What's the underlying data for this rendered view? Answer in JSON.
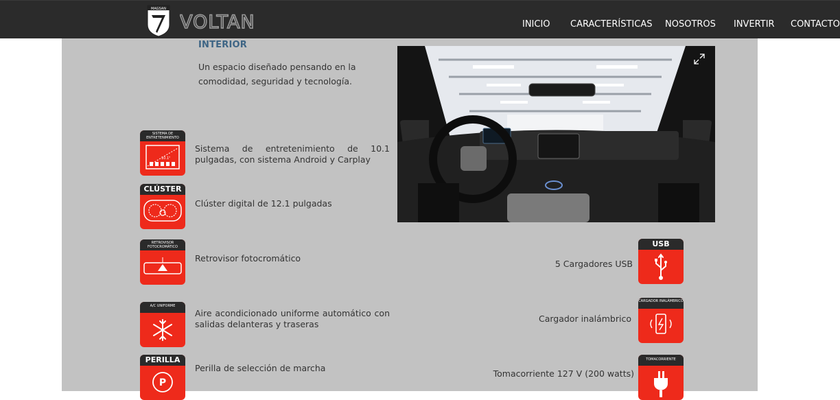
{
  "header": {
    "logo_badge_text": "MAGSAN",
    "logo_word": "VOLTAN",
    "nav": [
      {
        "label": "INICIO"
      },
      {
        "label": "CARACTERÍSTICAS"
      },
      {
        "label": "NOSOTROS"
      },
      {
        "label": "INVERTIR"
      },
      {
        "label": "CONTACTO"
      }
    ]
  },
  "section": {
    "title": "INTERIOR",
    "description": "Un espacio diseñado pensando en la comodidad, seguridad y tecnología."
  },
  "features_left": [
    {
      "icon_caption": "SISTEMA DE ENTRETENIMIENTO",
      "icon": "screen-size-icon",
      "text": "Sistema de entretenimiento de 10.1 pulgadas, con sistema Android y Carplay"
    },
    {
      "icon_caption": "CLÚSTER",
      "icon": "gauge-cluster-icon",
      "text": "Clúster digital de 12.1 pulgadas"
    },
    {
      "icon_caption": "RETROVISOR FOTOCROMÁTICO",
      "icon": "rearview-mirror-icon",
      "text": "Retrovisor fotocromático"
    },
    {
      "icon_caption": "A/C UNIFORME",
      "icon": "snowflake-icon",
      "text": "Aire acondicionado uniforme automático con salidas delanteras y traseras"
    },
    {
      "icon_caption": "PERILLA",
      "icon": "park-knob-icon",
      "text": "Perilla de selección de marcha"
    }
  ],
  "features_right": [
    {
      "icon_caption": "USB",
      "icon": "usb-icon",
      "text": "5 Cargadores USB"
    },
    {
      "icon_caption": "CARGADOR INALÁMBRICO",
      "icon": "wireless-charger-icon",
      "text": "Cargador inalámbrico"
    },
    {
      "icon_caption": "TOMACORRIENTE",
      "icon": "power-plug-icon",
      "text": "Tomacorriente 127 V (200 watts)"
    }
  ],
  "icon_inner_labels": {
    "screen_size": "10.1\""
  },
  "colors": {
    "header_bg": "#2b2b2b",
    "panel_bg": "#c2c2c2",
    "accent_red": "#ee2a1b",
    "title_blue": "#3e6585"
  }
}
